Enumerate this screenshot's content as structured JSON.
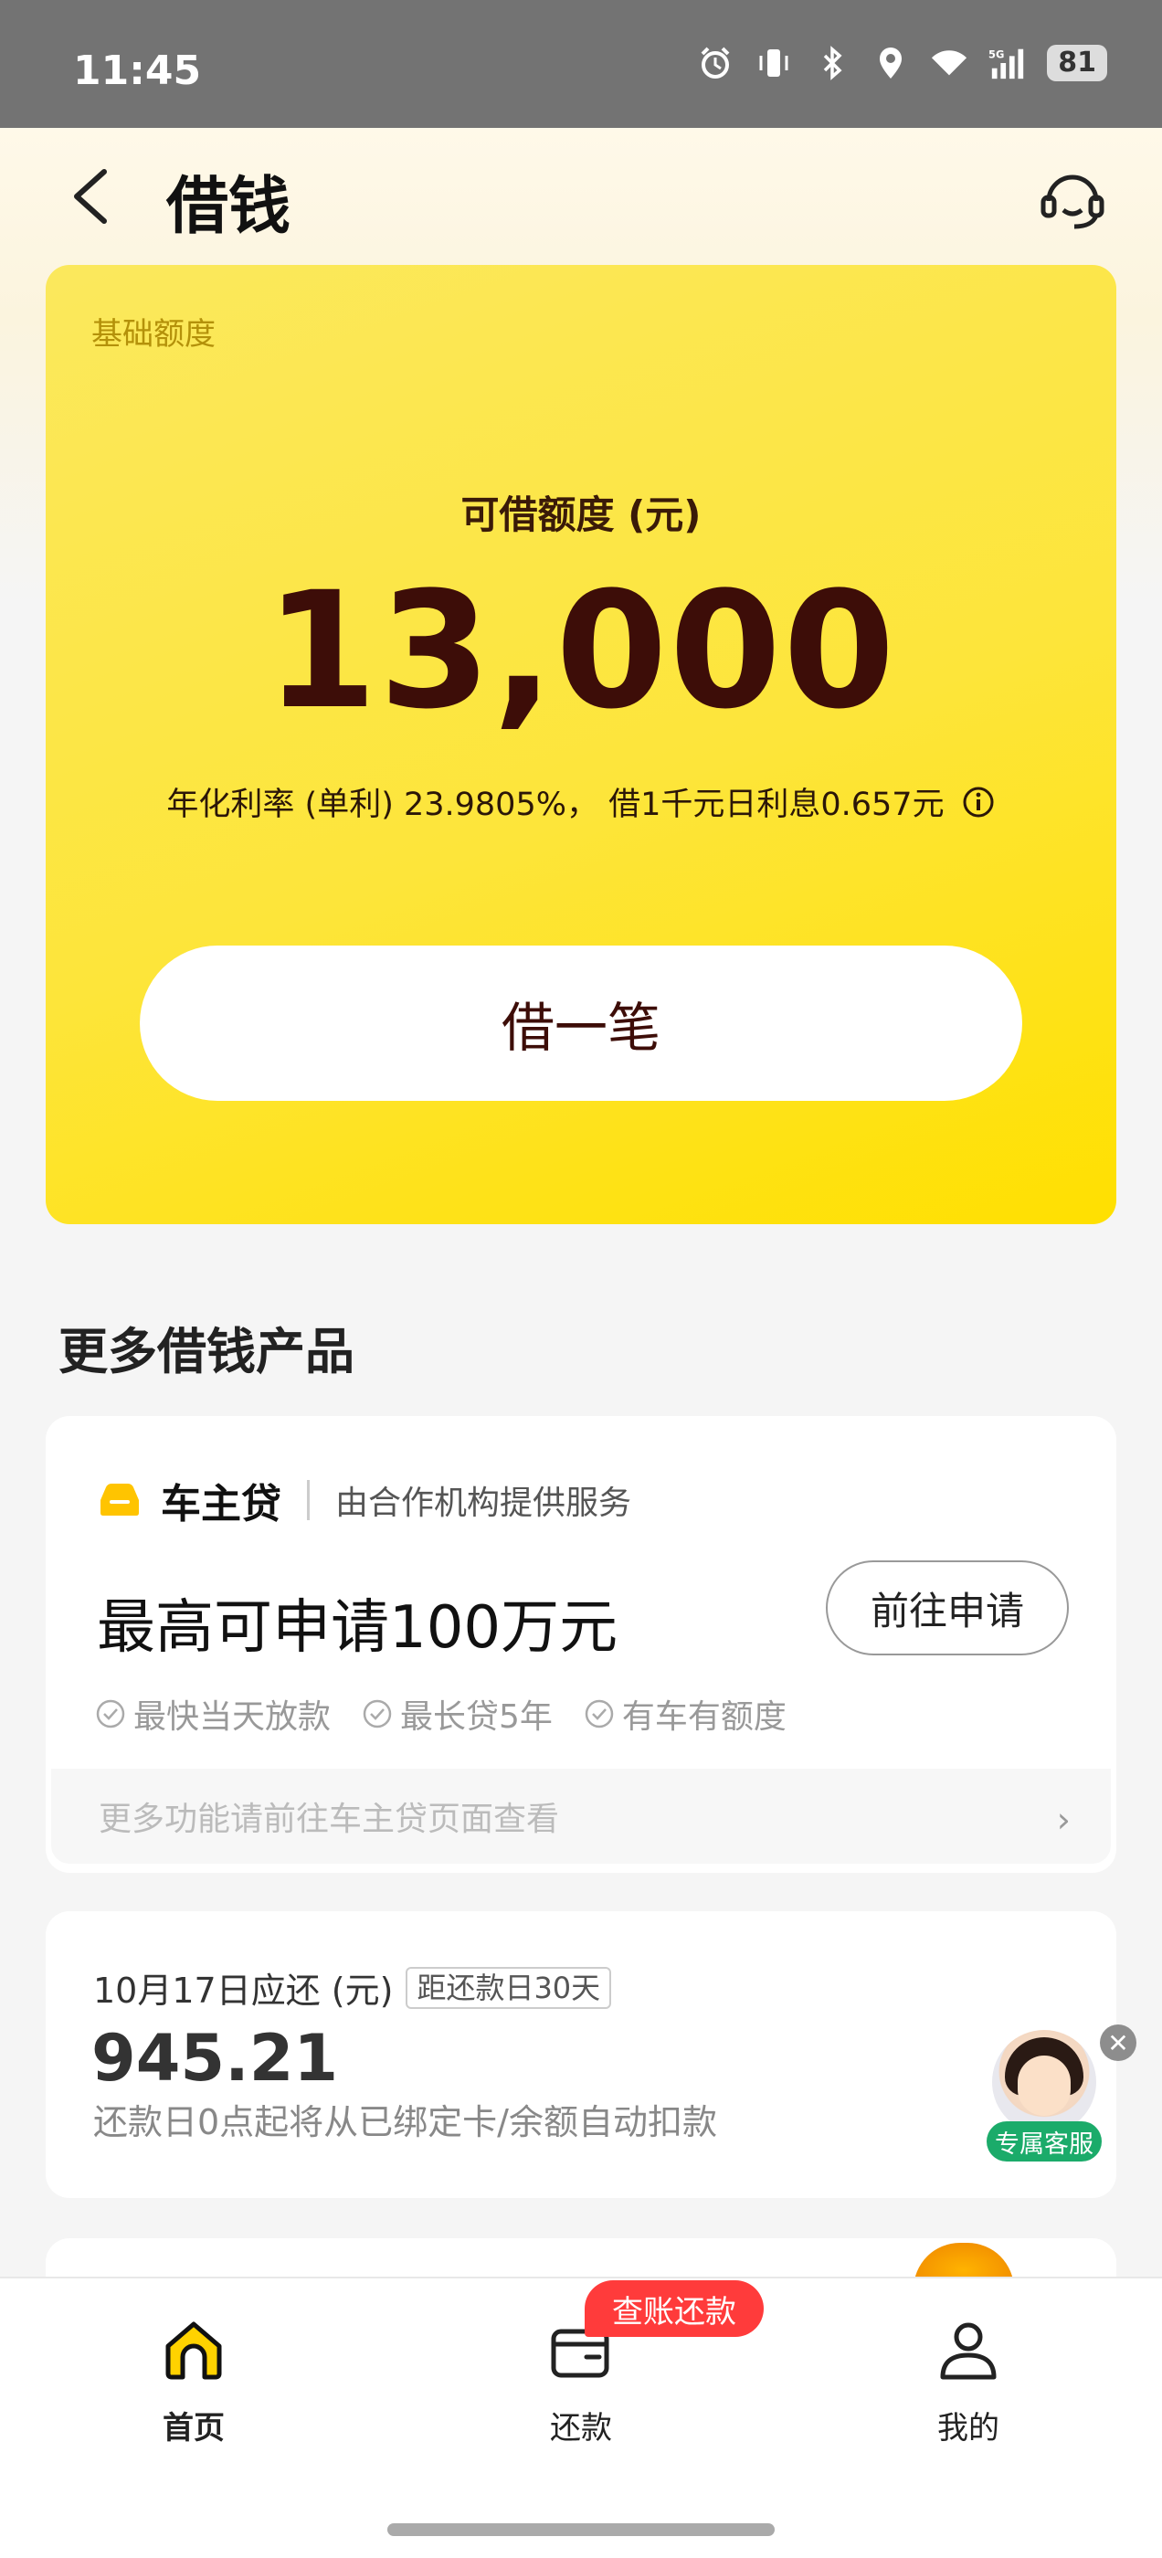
{
  "status_bar": {
    "time": "11:45",
    "battery": "81",
    "icons": [
      "alarm-icon",
      "vibrate-icon",
      "bluetooth-icon",
      "location-icon",
      "wifi-icon",
      "5g-signal-icon",
      "battery-icon"
    ]
  },
  "header": {
    "title": "借钱",
    "back_icon": "chevron-left-icon",
    "service_icon": "headset-icon"
  },
  "credit": {
    "tag": "基础额度",
    "label": "可借额度 (元)",
    "amount": "13,000",
    "rate_text": "年化利率 (单利) 23.9805%， 借1千元日利息0.657元",
    "borrow_button": "借一笔"
  },
  "more_products": {
    "title": "更多借钱产品",
    "car_loan": {
      "name": "车主贷",
      "provider": "由合作机构提供服务",
      "headline": "最高可申请100万元",
      "apply_button": "前往申请",
      "features": [
        "最快当天放款",
        "最长贷5年",
        "有车有额度"
      ],
      "more_text": "更多功能请前往车主贷页面查看"
    }
  },
  "repayment": {
    "due_label": "10月17日应还 (元)",
    "days_tag": "距还款日30天",
    "amount": "945.21",
    "note": "还款日0点起将从已绑定卡/余额自动扣款"
  },
  "floating_service": {
    "label": "专属客服"
  },
  "tabbar": {
    "promo_badge": "查账还款",
    "items": [
      {
        "label": "首页",
        "icon": "home-icon"
      },
      {
        "label": "还款",
        "icon": "wallet-icon"
      },
      {
        "label": "我的",
        "icon": "person-icon"
      }
    ]
  },
  "colors": {
    "card_yellow": "#fde53a",
    "amount_dark": "#3d0d08",
    "badge_red": "#ff3b3b",
    "service_green": "#1bab6a"
  }
}
